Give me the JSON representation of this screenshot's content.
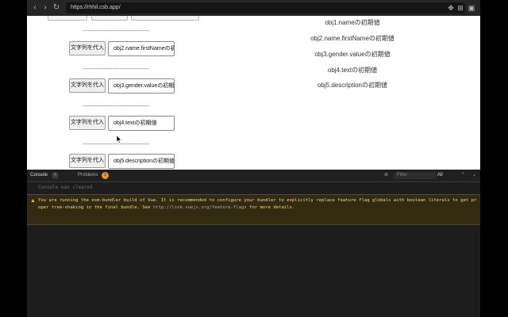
{
  "browser": {
    "url": "https://rhhil.csb.app/",
    "nav": {
      "back_icon": "arrow-left-icon",
      "forward_icon": "arrow-right-icon",
      "reload_icon": "reload-icon"
    }
  },
  "preview": {
    "divider": "------------------------------------",
    "rows": [
      {
        "button": "文字列を代入",
        "input": "obj2.name.firstNameの初"
      },
      {
        "button": "文字列を代入",
        "input": "obj3.gender.valueの初期"
      },
      {
        "button": "文字列を代入",
        "input": "obj4.textの初期値"
      },
      {
        "button": "文字列を代入",
        "input": "obj5.descriptionの初期値"
      }
    ],
    "values": [
      "obj1.nameの初期値",
      "obj2.name.firstNameの初期値",
      "obj3.gender.valueの初期値",
      "obj4.textの初期値",
      "obj5.descriptionの初期値"
    ]
  },
  "devtools": {
    "tabs": [
      {
        "label": "Console",
        "badge": "0"
      },
      {
        "label": "Problems",
        "badge": "1"
      }
    ],
    "filter_placeholder": "Filter",
    "level": "All",
    "cleared": "Console was cleared",
    "warning": "You are running the esm-bundler build of Vue. It is recommended to configure your bundler to explicitly replace feature flag globals with boolean literals to get proper tree-shaking in the final bundle. See",
    "warning_link": "http://link.vuejs.org/feature-flags",
    "warning_end": "for more details."
  },
  "colors": {
    "warning_bg": "#332a12",
    "warning_text": "#f6d694",
    "badge_orange": "#e8912d"
  }
}
